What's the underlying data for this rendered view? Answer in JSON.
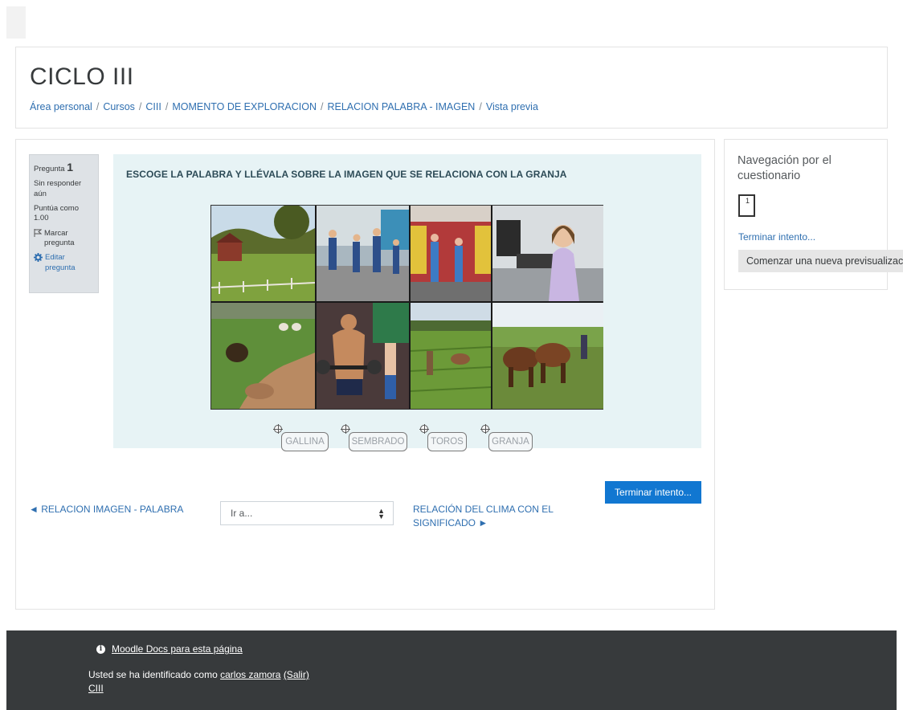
{
  "header": {
    "title": "CICLO III",
    "breadcrumb": [
      "Área personal",
      "Cursos",
      "CIII",
      "MOMENTO DE EXPLORACION",
      "RELACION PALABRA - IMAGEN",
      "Vista previa"
    ]
  },
  "question_info": {
    "label": "Pregunta",
    "number": "1",
    "status": "Sin responder aún",
    "grade": "Puntúa como 1.00",
    "flag_label": "Marcar pregunta",
    "edit_label": "Editar pregunta"
  },
  "question": {
    "text": "ESCOGE LA PALABRA Y LLÉVALA SOBRE LA IMAGEN QUE SE RELACIONA CON LA GRANJA",
    "drag_items": [
      "GALLINA",
      "SEMBRADO",
      "TOROS",
      "GRANJA"
    ]
  },
  "navigation": {
    "finish_button": "Terminar intento...",
    "prev_link": "◄ RELACION IMAGEN - PALABRA",
    "jump_placeholder": "Ir a...",
    "next_link": "RELACIÓN DEL CLIMA CON EL SIGNIFICADO ►"
  },
  "quiz_nav": {
    "title": "Navegación por el cuestionario",
    "question_box": "1",
    "end_link": "Terminar intento...",
    "restart_button": "Comenzar una nueva previsualizació"
  },
  "footer": {
    "docs_link": "Moodle Docs para esta página",
    "login_prefix": "Usted se ha identificado como",
    "user_name": "carlos zamora",
    "logout_label": "(Salir)",
    "course_link": "CIII"
  },
  "colors": {
    "link": "#2f6fb0",
    "primary_button": "#1177d1",
    "question_bg": "#e7f3f5",
    "footer_bg": "#373a3c"
  }
}
